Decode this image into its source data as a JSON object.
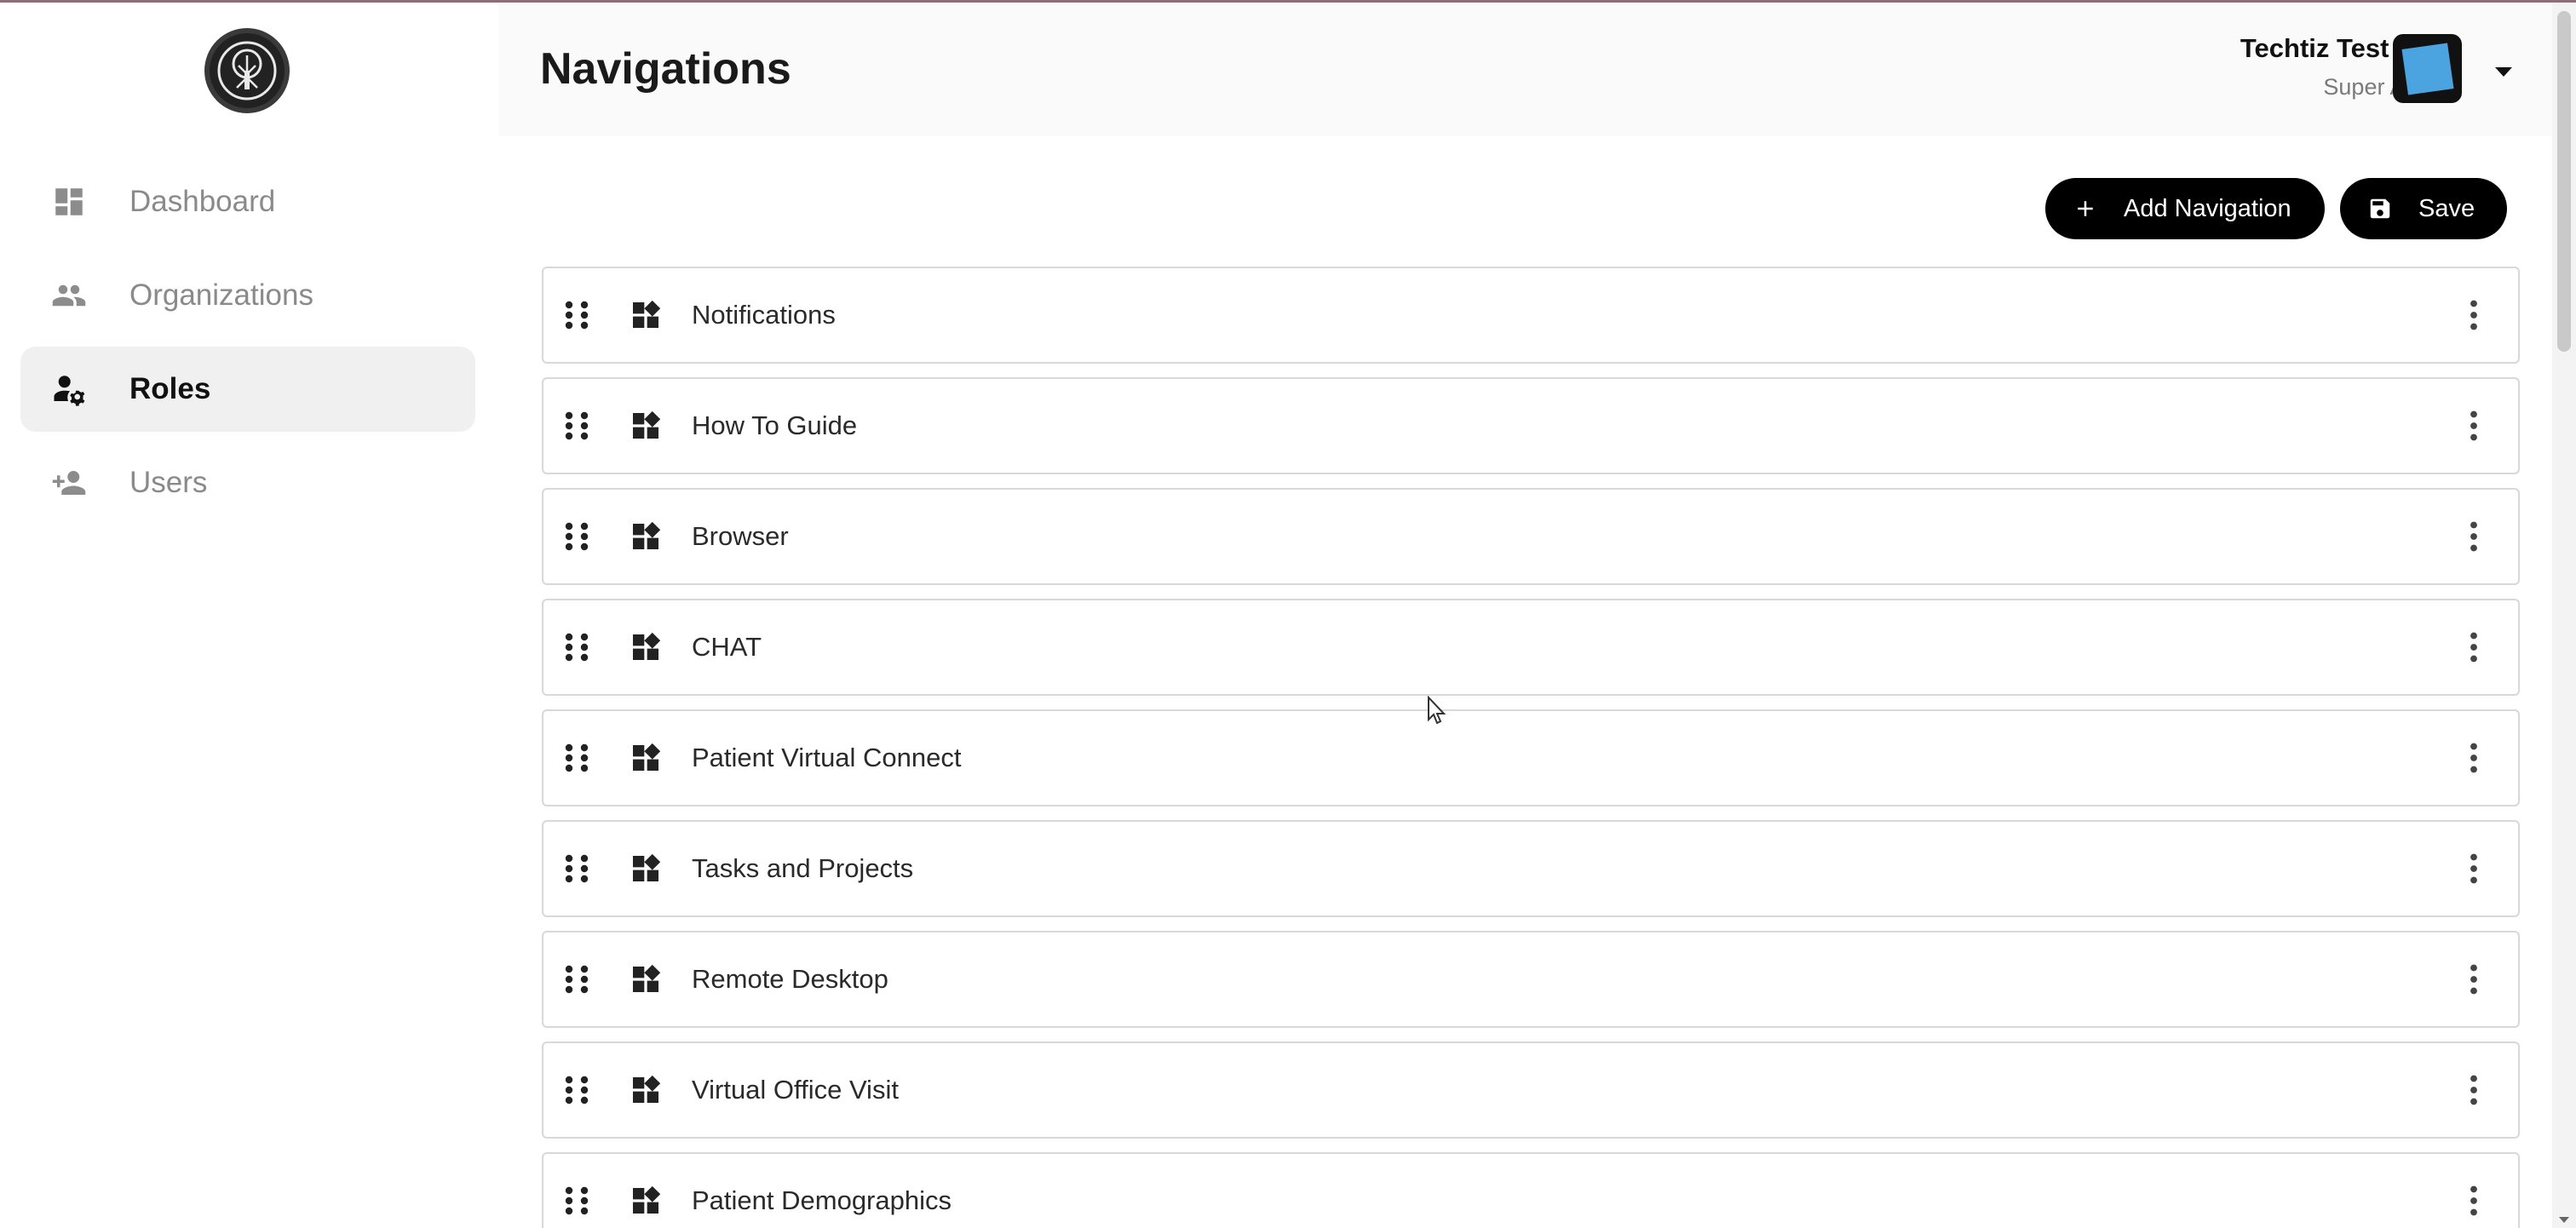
{
  "header": {
    "title": "Navigations",
    "user_name": "Techtiz Test User",
    "user_role": "Super Admin"
  },
  "sidebar": {
    "items": [
      {
        "label": "Dashboard",
        "icon": "dashboard-icon",
        "active": false
      },
      {
        "label": "Organizations",
        "icon": "people-icon",
        "active": false
      },
      {
        "label": "Roles",
        "icon": "user-gear-icon",
        "active": true
      },
      {
        "label": "Users",
        "icon": "user-add-icon",
        "active": false
      }
    ]
  },
  "actions": {
    "add_label": "Add Navigation",
    "save_label": "Save"
  },
  "navigations": [
    "Notifications",
    "How To Guide",
    "Browser",
    "CHAT",
    "Patient Virtual Connect",
    "Tasks and Projects",
    "Remote Desktop",
    "Virtual Office Visit",
    "Patient Demographics"
  ],
  "colors": {
    "active_bg": "#f0f0f0",
    "button_bg": "#000000",
    "avatar": "#4ba3e0"
  }
}
